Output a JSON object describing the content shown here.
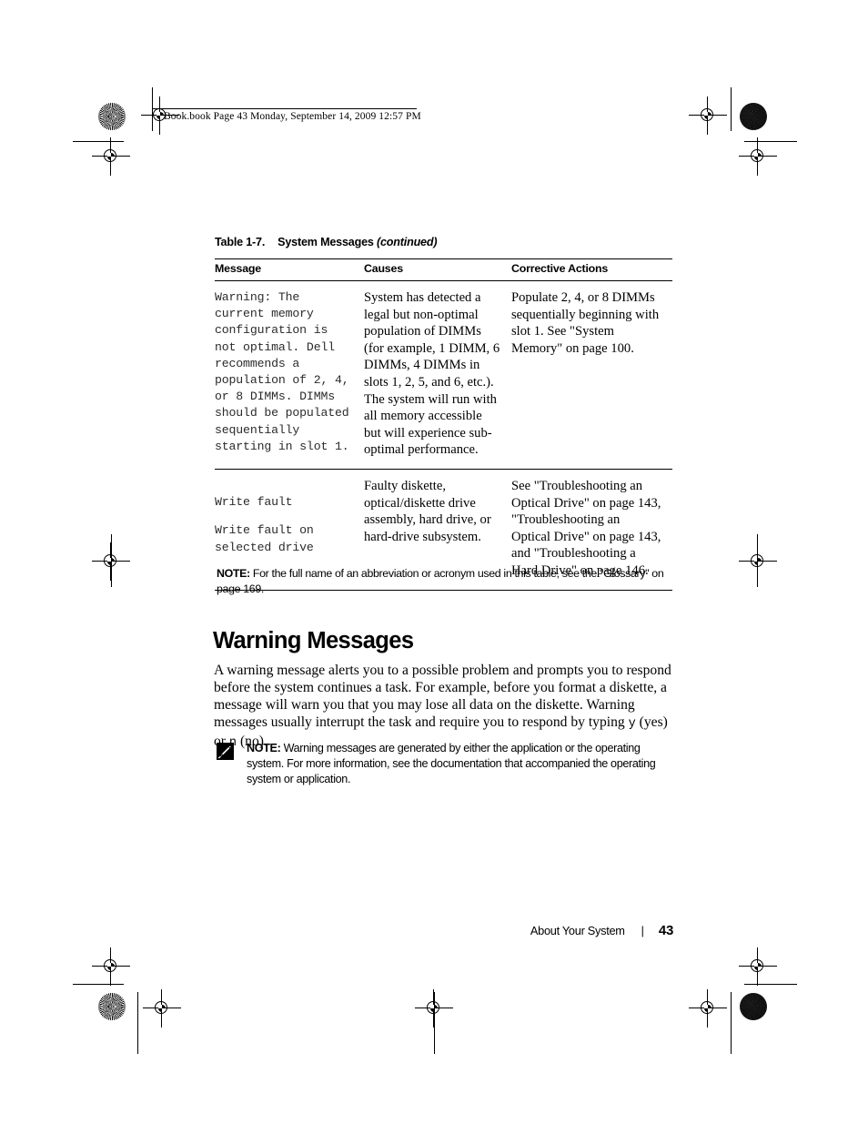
{
  "page_header": {
    "text": "Book.book  Page 43  Monday, September 14, 2009  12:57 PM"
  },
  "table": {
    "caption_number": "Table 1-7.",
    "caption_title": "System Messages",
    "caption_continued": "(continued)",
    "columns": [
      "Message",
      "Causes",
      "Corrective Actions"
    ],
    "rows": [
      {
        "message": "Warning: The current memory configuration is not optimal. Dell recommends a population of 2, 4, or 8 DIMMs. DIMMs should be populated sequentially starting in slot 1.",
        "causes": "System has detected a legal but non-optimal population of DIMMs (for example, 1 DIMM, 6 DIMMs, 4 DIMMs in slots 1, 2, 5, and 6, etc.). The system will run with all memory accessible but will experience sub-optimal performance.",
        "actions": "Populate 2, 4, or 8 DIMMs sequentially beginning with slot 1. See \"System Memory\" on page 100."
      },
      {
        "message_line1": "Write fault",
        "message_line2": "Write fault on selected drive",
        "causes": "Faulty diskette, optical/diskette drive assembly, hard drive, or hard-drive subsystem.",
        "actions": "See \"Troubleshooting an Optical Drive\" on page 143, \"Troubleshooting an Optical Drive\" on page 143, and \"Troubleshooting a Hard Drive\" on page 146."
      }
    ]
  },
  "table_note": {
    "label": "NOTE:",
    "text": " For the full name of an abbreviation or acronym used in this table, see the \"Glossary\" on page 169."
  },
  "section": {
    "heading": "Warning Messages",
    "paragraph_part1": "A warning message alerts you to a possible problem and prompts you to respond before the system continues a task. For example, before you format a diskette, a message will warn you that you may lose all data on the diskette. Warning messages usually interrupt the task and require you to respond by typing ",
    "paragraph_mono1": "y",
    "paragraph_part2": " (yes) or ",
    "paragraph_mono2": "n",
    "paragraph_part3": " (no)."
  },
  "icon_note": {
    "icon": "pencil-note-icon",
    "label": "NOTE:",
    "text": " Warning messages are generated by either the application or the operating system. For more information, see the documentation that accompanied the operating system or application."
  },
  "footer": {
    "title": "About Your System",
    "separator": "|",
    "page_number": "43"
  },
  "colors": {
    "ink": "#000000",
    "page": "#ffffff",
    "mono_text": "#2b2b2b"
  }
}
